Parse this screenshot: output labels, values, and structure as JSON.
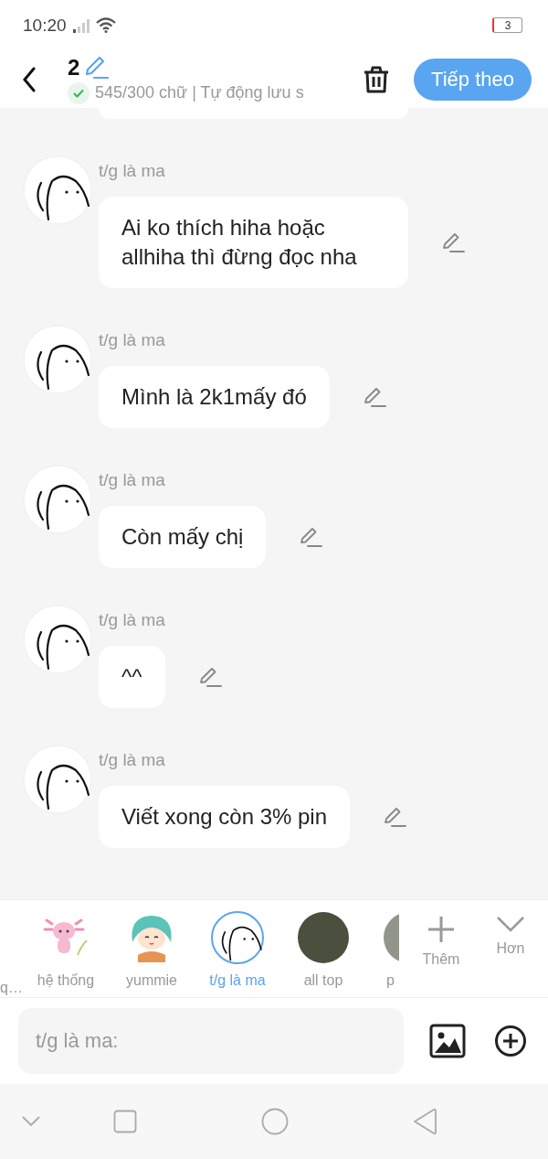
{
  "status_bar": {
    "time": "10:20",
    "battery": "3"
  },
  "header": {
    "title": "2",
    "word_count": "545/300 chữ | Tự động lưu s",
    "saved": true,
    "next_button": "Tiếp theo"
  },
  "messages": [
    {
      "author": "t/g là ma",
      "text": "Ai ko thích hiha hoặc allhiha thì đừng đọc nha"
    },
    {
      "author": "t/g là ma",
      "text": "Mình là 2k1mấy đó"
    },
    {
      "author": "t/g là ma",
      "text": "Còn mấy chị"
    },
    {
      "author": "t/g là ma",
      "text": "^^"
    },
    {
      "author": "t/g là ma",
      "text": "Viết xong còn 3% pin"
    }
  ],
  "characters": [
    {
      "name": "q…",
      "kind": "cut-left",
      "selected": false
    },
    {
      "name": "hệ thống",
      "kind": "axolotl",
      "selected": false
    },
    {
      "name": "yummie",
      "kind": "girl",
      "selected": false
    },
    {
      "name": "t/g là ma",
      "kind": "doodle",
      "selected": true
    },
    {
      "name": "all top",
      "kind": "photo",
      "selected": false
    },
    {
      "name": "p",
      "kind": "cut-photo",
      "selected": false
    }
  ],
  "actions": [
    {
      "label": "Thêm",
      "kind": "add"
    },
    {
      "label": "Hơn",
      "kind": "more"
    }
  ],
  "composer": {
    "placeholder": "t/g là ma:"
  }
}
